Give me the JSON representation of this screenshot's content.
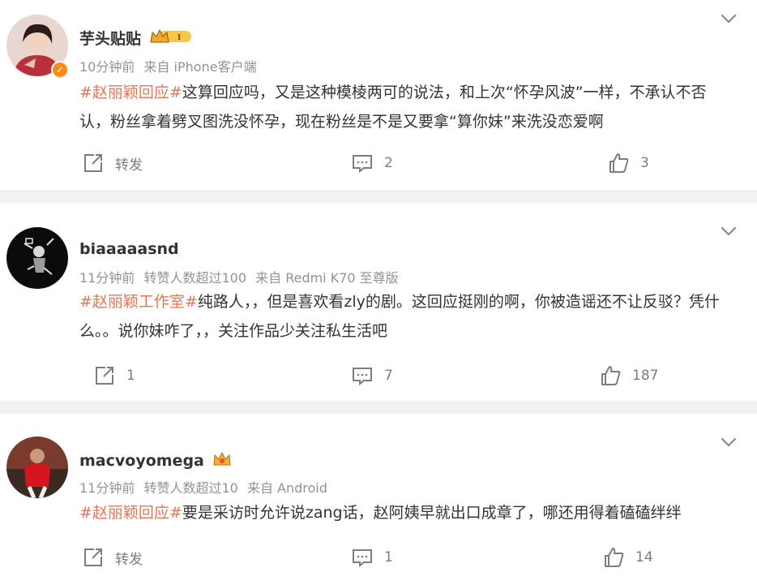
{
  "posts": [
    {
      "name": "芋头贴贴",
      "has_level_badge": true,
      "level_badge_text": "I",
      "meta": [
        "10分钟前",
        "来自 iPhone客户端"
      ],
      "tag": "#赵丽颖回应#",
      "text": "这算回应吗，又是这种模棱两可的说法，和上次“怀孕风波”一样，不承认不否认，粉丝拿着劈叉图洗没怀孕，现在粉丝是不是又要拿“算你妹”来洗没恋爱啊",
      "repost_label": "转发",
      "comment_count": "2",
      "like_count": "3"
    },
    {
      "name": "biaaaaasnd",
      "meta": [
        "11分钟前",
        "转赞人数超过100",
        "来自 Redmi K70 至尊版"
      ],
      "tag": "#赵丽颖工作室#",
      "text": "纯路人，，但是喜欢看zly的剧。这回应挺刚的啊，你被造谣还不让反驳？凭什么。。说你妹咋了，，关注作品少关注私生活吧",
      "repost_label": "1",
      "comment_count": "7",
      "like_count": "187"
    },
    {
      "name": "macvoyomega",
      "meta": [
        "11分钟前",
        "转赞人数超过10",
        "来自 Android"
      ],
      "tag": "#赵丽颖回应#",
      "text": "要是采访时允许说zang话，赵阿姨早就出口成章了，哪还用得着磕磕绊绊",
      "repost_label": "转发",
      "comment_count": "1",
      "like_count": "14"
    }
  ],
  "colors": {
    "tag": "#eb7350",
    "meta": "#939393",
    "action": "#7d7d7d",
    "verified": "#f78c1a",
    "separator": "#f2f2f2"
  },
  "icons": [
    "chevron-down-icon",
    "repost-icon",
    "comment-icon",
    "like-icon",
    "verified-icon",
    "crown-level-icon",
    "crown-fan-icon"
  ]
}
